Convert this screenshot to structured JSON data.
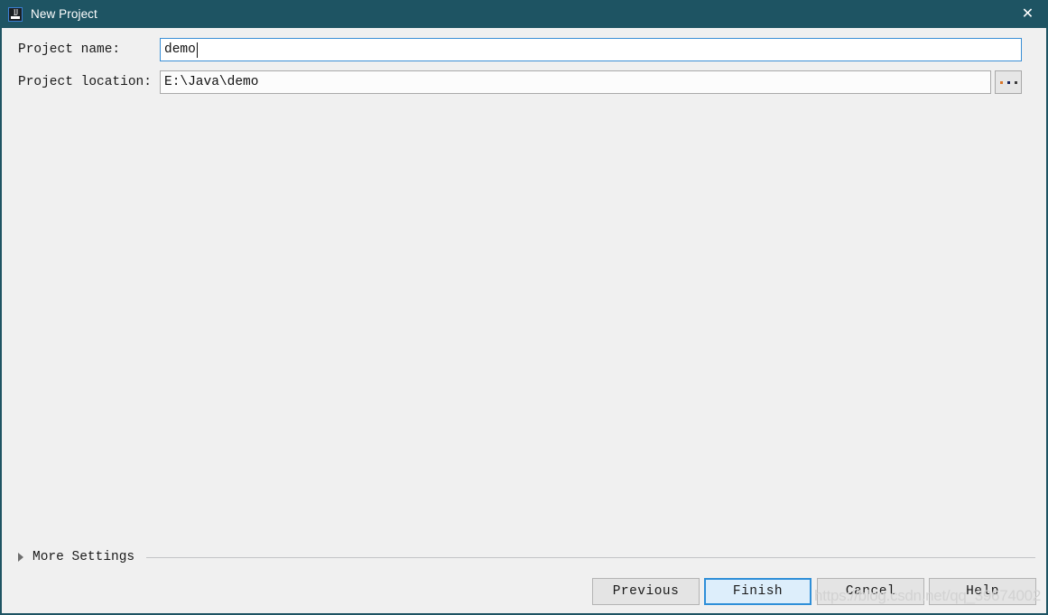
{
  "window": {
    "title": "New Project",
    "icon": "intellij-idea-icon",
    "close_label": "✕",
    "titlebar_color": "#1e5463",
    "background_color": "#f0f0f0"
  },
  "form": {
    "fields": [
      {
        "label": "Project name:",
        "value": "demo",
        "focused": true,
        "has_caret": true
      },
      {
        "label": "Project location:",
        "value": "E:\\Java\\demo",
        "focused": false,
        "has_caret": false
      }
    ],
    "browse_button": {
      "label": "...",
      "dot_colors": [
        "#d9762a",
        "#17245c",
        "#3b3b3b"
      ]
    }
  },
  "more_settings": {
    "label": "More Settings",
    "expanded": false,
    "arrow": "▶"
  },
  "footer": {
    "buttons": [
      {
        "label": "Previous",
        "default": false
      },
      {
        "label": "Finish",
        "default": true
      },
      {
        "label": "Cancel",
        "default": false
      },
      {
        "label": "Help",
        "default": false
      }
    ],
    "accent_color": "#2f8fd8"
  },
  "watermark": {
    "text": "https://blog.csdn.net/qq_39674002"
  }
}
